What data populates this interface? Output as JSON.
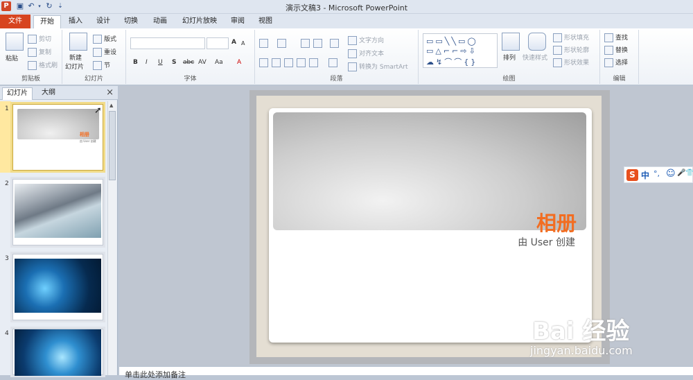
{
  "window": {
    "title": "演示文稿3  -  Microsoft PowerPoint"
  },
  "tabs": [
    {
      "label": "文件"
    },
    {
      "label": "开始"
    },
    {
      "label": "插入"
    },
    {
      "label": "设计"
    },
    {
      "label": "切换"
    },
    {
      "label": "动画"
    },
    {
      "label": "幻灯片放映"
    },
    {
      "label": "审阅"
    },
    {
      "label": "视图"
    }
  ],
  "ribbon": {
    "clipboard": {
      "paste": "粘贴",
      "cut": "剪切",
      "copy": "复制",
      "format_painter": "格式刷",
      "label": "剪贴板"
    },
    "slides": {
      "new_slide_1": "新建",
      "new_slide_2": "幻灯片",
      "layout": "版式",
      "reset": "重设",
      "section": "节",
      "label": "幻灯片"
    },
    "font": {
      "label": "字体",
      "bold": "B",
      "italic": "I",
      "underline": "U",
      "shadow": "S",
      "strike": "abc",
      "spacing": "AV",
      "case": "Aa",
      "grow": "A",
      "shrink": "A"
    },
    "paragraph": {
      "label": "段落",
      "text_direction": "文字方向",
      "align_text": "对齐文本",
      "smartart": "转换为 SmartArt"
    },
    "drawing": {
      "label": "绘图",
      "arrange": "排列",
      "quick_styles": "快速样式",
      "fill": "形状填充",
      "outline": "形状轮廓",
      "effects": "形状效果"
    },
    "editing": {
      "label": "编辑",
      "find": "查找",
      "replace": "替换",
      "select": "选择"
    }
  },
  "pane": {
    "tab_slides": "幻灯片",
    "tab_outline": "大纲",
    "close": "×"
  },
  "thumbnails": [
    {
      "num": "1",
      "title": "相册",
      "sub": "由 User 创建"
    },
    {
      "num": "2"
    },
    {
      "num": "3"
    },
    {
      "num": "4"
    }
  ],
  "slide": {
    "title": "相册",
    "subtitle": "由 User 创建"
  },
  "notes": {
    "placeholder": "单击此处添加备注"
  },
  "ime": {
    "logo": "S",
    "lang": "中",
    "punct": "°,",
    "emoji": "☺",
    "mic": "🎤",
    "shirt": "👕"
  },
  "watermark": {
    "brand": "Bai  经验",
    "url": "jingyan.baidu.com"
  }
}
